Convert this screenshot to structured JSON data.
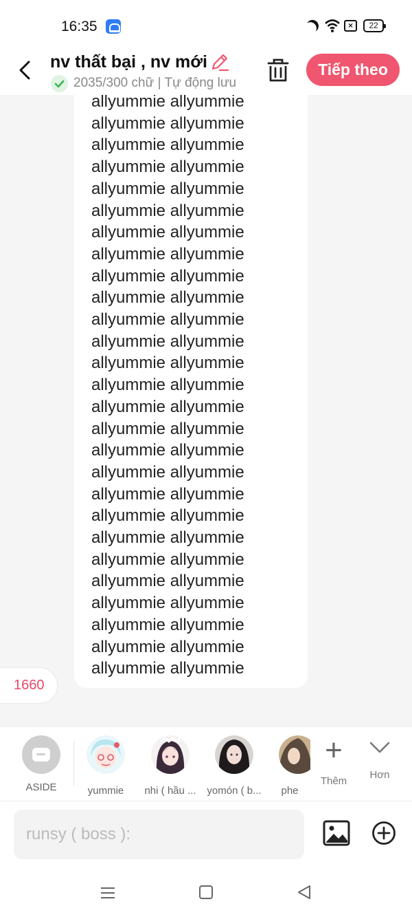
{
  "status_bar": {
    "time": "16:35",
    "battery": "22"
  },
  "header": {
    "title": "nv thất bại , nv mới",
    "subtitle": "2035/300 chữ | Tự động lưu",
    "next_label": "Tiếp theo"
  },
  "content": {
    "line_text": "allyummie allyummie",
    "line_count": 27,
    "counter": "1660"
  },
  "characters": [
    {
      "name": "ASIDE",
      "icon": "aside-icon"
    },
    {
      "name": "yummie",
      "icon": "avatar"
    },
    {
      "name": "nhi ( hầu ...",
      "icon": "avatar"
    },
    {
      "name": "yomón ( b...",
      "icon": "avatar"
    },
    {
      "name": "phe",
      "icon": "avatar"
    }
  ],
  "char_actions": {
    "add_label": "Thêm",
    "more_label": "Hơn"
  },
  "input": {
    "placeholder": "runsy ( boss ):"
  },
  "colors": {
    "accent": "#f0566f",
    "counter": "#e84868",
    "check": "#3cb55a"
  }
}
